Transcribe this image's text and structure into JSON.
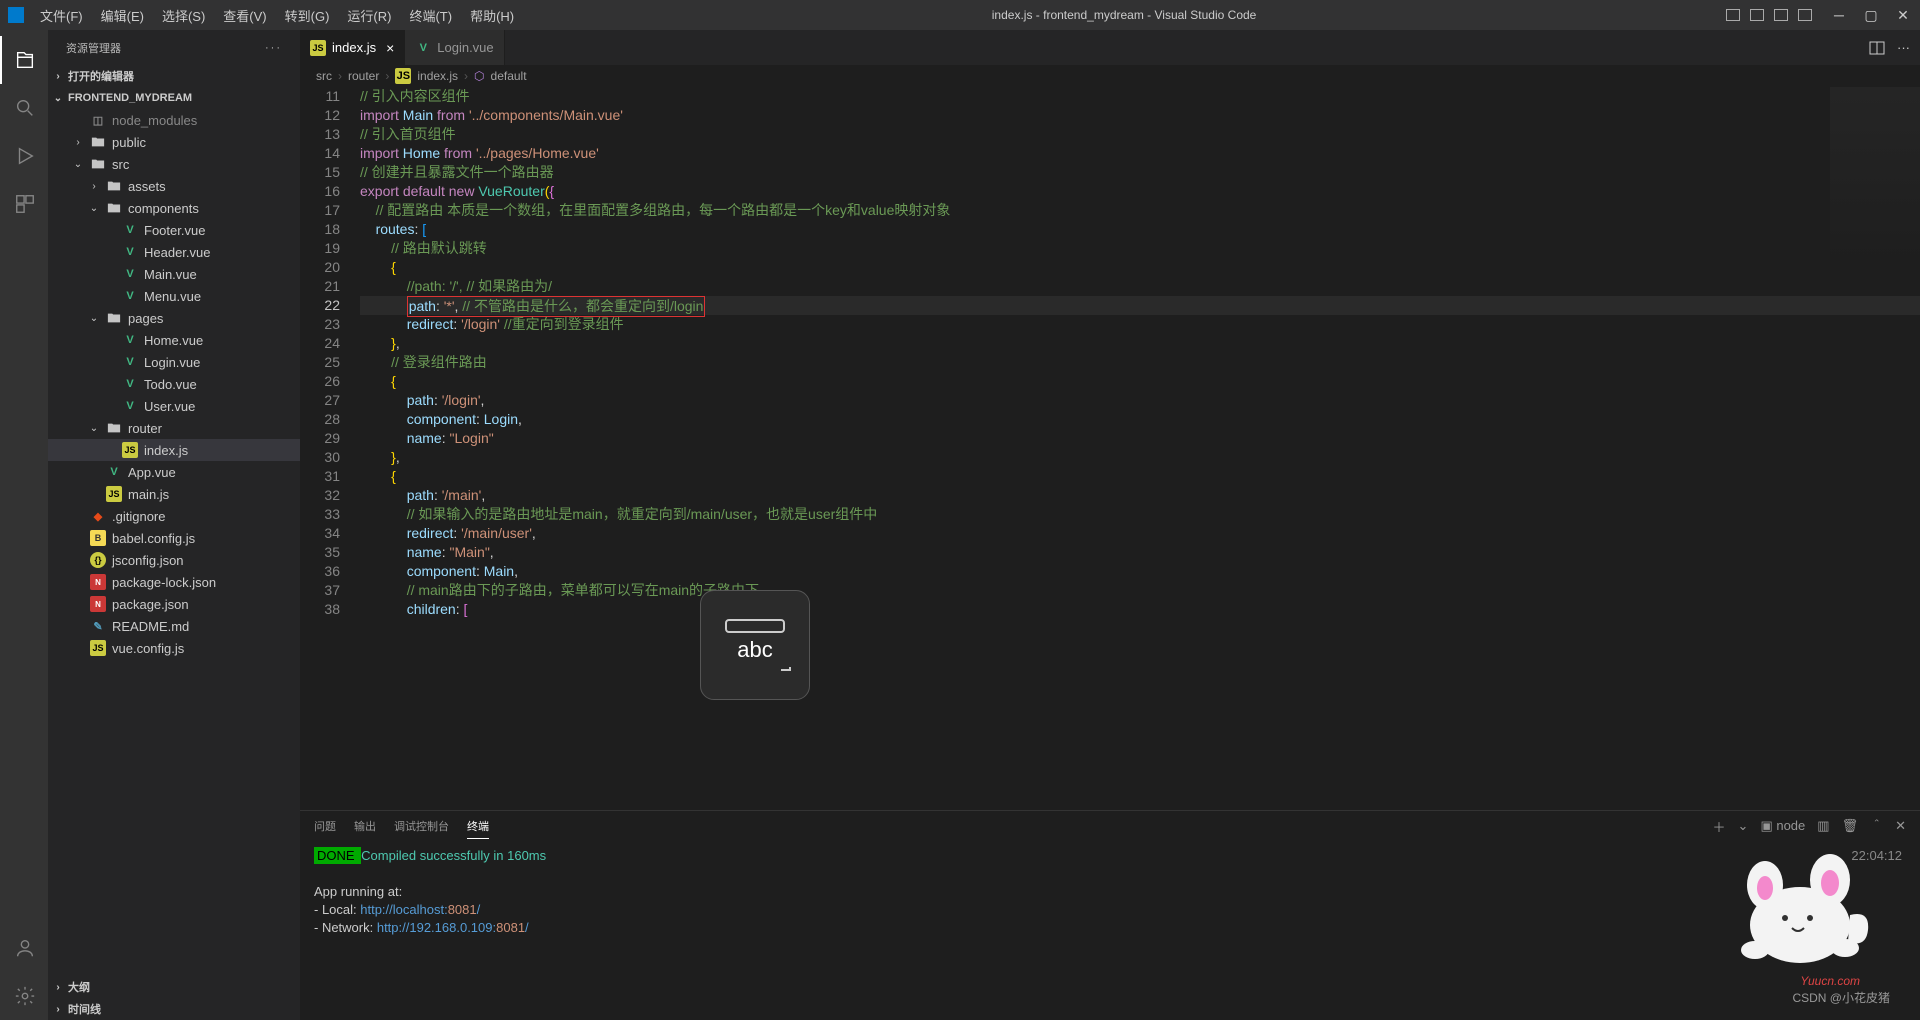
{
  "window": {
    "title": "index.js - frontend_mydream - Visual Studio Code"
  },
  "menu": [
    "文件(F)",
    "编辑(E)",
    "选择(S)",
    "查看(V)",
    "转到(G)",
    "运行(R)",
    "终端(T)",
    "帮助(H)"
  ],
  "sidebar": {
    "title": "资源管理器",
    "sections": {
      "openEditors": "打开的编辑器",
      "project": "FRONTEND_MYDREAM",
      "outline": "大纲",
      "timeline": "时间线"
    },
    "tree": [
      {
        "l": 1,
        "exp": null,
        "icon": "gray",
        "label": "node_modules",
        "dim": true
      },
      {
        "l": 1,
        "exp": false,
        "icon": "folder",
        "label": "public"
      },
      {
        "l": 1,
        "exp": true,
        "icon": "folder",
        "label": "src"
      },
      {
        "l": 2,
        "exp": false,
        "icon": "folder",
        "label": "assets"
      },
      {
        "l": 2,
        "exp": true,
        "icon": "folder",
        "label": "components"
      },
      {
        "l": 3,
        "exp": null,
        "icon": "vue",
        "label": "Footer.vue"
      },
      {
        "l": 3,
        "exp": null,
        "icon": "vue",
        "label": "Header.vue"
      },
      {
        "l": 3,
        "exp": null,
        "icon": "vue",
        "label": "Main.vue"
      },
      {
        "l": 3,
        "exp": null,
        "icon": "vue",
        "label": "Menu.vue"
      },
      {
        "l": 2,
        "exp": true,
        "icon": "folder",
        "label": "pages"
      },
      {
        "l": 3,
        "exp": null,
        "icon": "vue",
        "label": "Home.vue"
      },
      {
        "l": 3,
        "exp": null,
        "icon": "vue",
        "label": "Login.vue"
      },
      {
        "l": 3,
        "exp": null,
        "icon": "vue",
        "label": "Todo.vue"
      },
      {
        "l": 3,
        "exp": null,
        "icon": "vue",
        "label": "User.vue"
      },
      {
        "l": 2,
        "exp": true,
        "icon": "folder",
        "label": "router"
      },
      {
        "l": 3,
        "exp": null,
        "icon": "js",
        "label": "index.js",
        "active": true
      },
      {
        "l": 2,
        "exp": null,
        "icon": "vue",
        "label": "App.vue"
      },
      {
        "l": 2,
        "exp": null,
        "icon": "js",
        "label": "main.js"
      },
      {
        "l": 1,
        "exp": null,
        "icon": "git",
        "label": ".gitignore"
      },
      {
        "l": 1,
        "exp": null,
        "icon": "babel",
        "label": "babel.config.js"
      },
      {
        "l": 1,
        "exp": null,
        "icon": "json",
        "label": "jsconfig.json"
      },
      {
        "l": 1,
        "exp": null,
        "icon": "npm",
        "label": "package-lock.json"
      },
      {
        "l": 1,
        "exp": null,
        "icon": "npm",
        "label": "package.json"
      },
      {
        "l": 1,
        "exp": null,
        "icon": "md",
        "label": "README.md"
      },
      {
        "l": 1,
        "exp": null,
        "icon": "js",
        "label": "vue.config.js"
      }
    ]
  },
  "tabs": [
    {
      "icon": "js",
      "label": "index.js",
      "active": true,
      "close": true
    },
    {
      "icon": "vue",
      "label": "Login.vue",
      "active": false,
      "close": false
    }
  ],
  "breadcrumb": [
    "src",
    "router",
    "index.js",
    "default"
  ],
  "code": {
    "startLine": 11,
    "currentLine": 22,
    "lines": [
      [
        {
          "t": "cmt",
          "v": "// 引入内容区组件"
        }
      ],
      [
        {
          "t": "kw",
          "v": "import"
        },
        {
          "t": "pun",
          "v": " "
        },
        {
          "t": "var",
          "v": "Main"
        },
        {
          "t": "pun",
          "v": " "
        },
        {
          "t": "kw",
          "v": "from"
        },
        {
          "t": "pun",
          "v": " "
        },
        {
          "t": "str",
          "v": "'../components/Main.vue'"
        }
      ],
      [
        {
          "t": "cmt",
          "v": "// 引入首页组件"
        }
      ],
      [
        {
          "t": "kw",
          "v": "import"
        },
        {
          "t": "pun",
          "v": " "
        },
        {
          "t": "var",
          "v": "Home"
        },
        {
          "t": "pun",
          "v": " "
        },
        {
          "t": "kw",
          "v": "from"
        },
        {
          "t": "pun",
          "v": " "
        },
        {
          "t": "str",
          "v": "'../pages/Home.vue'"
        }
      ],
      [
        {
          "t": "cmt",
          "v": "// 创建并且暴露文件一个路由器"
        }
      ],
      [
        {
          "t": "kw",
          "v": "export"
        },
        {
          "t": "pun",
          "v": " "
        },
        {
          "t": "kw",
          "v": "default"
        },
        {
          "t": "pun",
          "v": " "
        },
        {
          "t": "kw",
          "v": "new"
        },
        {
          "t": "pun",
          "v": " "
        },
        {
          "t": "type",
          "v": "VueRouter"
        },
        {
          "t": "brace1",
          "v": "("
        },
        {
          "t": "brace2",
          "v": "{"
        }
      ],
      [
        {
          "t": "pun",
          "v": "    "
        },
        {
          "t": "cmt",
          "v": "// 配置路由 本质是一个数组，在里面配置多组路由，每一个路由都是一个key和value映射对象"
        }
      ],
      [
        {
          "t": "pun",
          "v": "    "
        },
        {
          "t": "var",
          "v": "routes"
        },
        {
          "t": "pun",
          "v": ": "
        },
        {
          "t": "brace3",
          "v": "["
        }
      ],
      [
        {
          "t": "pun",
          "v": "        "
        },
        {
          "t": "cmt",
          "v": "// 路由默认跳转"
        }
      ],
      [
        {
          "t": "pun",
          "v": "        "
        },
        {
          "t": "brace1",
          "v": "{"
        }
      ],
      [
        {
          "t": "pun",
          "v": "            "
        },
        {
          "t": "cmt",
          "v": "//path: '/', // 如果路由为/"
        }
      ],
      [
        {
          "t": "pun",
          "v": "            "
        },
        {
          "red": true,
          "parts": [
            {
              "t": "var",
              "v": "path"
            },
            {
              "t": "pun",
              "v": ": "
            },
            {
              "t": "str",
              "v": "'*'"
            },
            {
              "t": "pun",
              "v": ", "
            },
            {
              "t": "cmt",
              "v": "// 不管路由是什么，都会重定向到/login"
            }
          ]
        }
      ],
      [
        {
          "t": "pun",
          "v": "            "
        },
        {
          "t": "var",
          "v": "redirect"
        },
        {
          "t": "pun",
          "v": ": "
        },
        {
          "t": "str",
          "v": "'/login'"
        },
        {
          "t": "pun",
          "v": " "
        },
        {
          "t": "cmt",
          "v": "//重定向到登录组件"
        }
      ],
      [
        {
          "t": "pun",
          "v": "        "
        },
        {
          "t": "brace1",
          "v": "}"
        },
        {
          "t": "pun",
          "v": ","
        }
      ],
      [
        {
          "t": "pun",
          "v": "        "
        },
        {
          "t": "cmt",
          "v": "// 登录组件路由"
        }
      ],
      [
        {
          "t": "pun",
          "v": "        "
        },
        {
          "t": "brace1",
          "v": "{"
        }
      ],
      [
        {
          "t": "pun",
          "v": "            "
        },
        {
          "t": "var",
          "v": "path"
        },
        {
          "t": "pun",
          "v": ": "
        },
        {
          "t": "str",
          "v": "'/login'"
        },
        {
          "t": "pun",
          "v": ","
        }
      ],
      [
        {
          "t": "pun",
          "v": "            "
        },
        {
          "t": "var",
          "v": "component"
        },
        {
          "t": "pun",
          "v": ": "
        },
        {
          "t": "var",
          "v": "Login"
        },
        {
          "t": "pun",
          "v": ","
        }
      ],
      [
        {
          "t": "pun",
          "v": "            "
        },
        {
          "t": "var",
          "v": "name"
        },
        {
          "t": "pun",
          "v": ": "
        },
        {
          "t": "str",
          "v": "\"Login\""
        }
      ],
      [
        {
          "t": "pun",
          "v": "        "
        },
        {
          "t": "brace1",
          "v": "}"
        },
        {
          "t": "pun",
          "v": ","
        }
      ],
      [
        {
          "t": "pun",
          "v": "        "
        },
        {
          "t": "brace1",
          "v": "{"
        }
      ],
      [
        {
          "t": "pun",
          "v": "            "
        },
        {
          "t": "var",
          "v": "path"
        },
        {
          "t": "pun",
          "v": ": "
        },
        {
          "t": "str",
          "v": "'/main'"
        },
        {
          "t": "pun",
          "v": ","
        }
      ],
      [
        {
          "t": "pun",
          "v": "            "
        },
        {
          "t": "cmt",
          "v": "// 如果输入的是路由地址是main，就重定向到/main/user，也就是user组件中"
        }
      ],
      [
        {
          "t": "pun",
          "v": "            "
        },
        {
          "t": "var",
          "v": "redirect"
        },
        {
          "t": "pun",
          "v": ": "
        },
        {
          "t": "str",
          "v": "'/main/user'"
        },
        {
          "t": "pun",
          "v": ","
        }
      ],
      [
        {
          "t": "pun",
          "v": "            "
        },
        {
          "t": "var",
          "v": "name"
        },
        {
          "t": "pun",
          "v": ": "
        },
        {
          "t": "str",
          "v": "\"Main\""
        },
        {
          "t": "pun",
          "v": ","
        }
      ],
      [
        {
          "t": "pun",
          "v": "            "
        },
        {
          "t": "var",
          "v": "component"
        },
        {
          "t": "pun",
          "v": ": "
        },
        {
          "t": "var",
          "v": "Main"
        },
        {
          "t": "pun",
          "v": ","
        }
      ],
      [
        {
          "t": "pun",
          "v": "            "
        },
        {
          "t": "cmt",
          "v": "// main路由下的子路由，菜单都可以写在main的子路由下"
        }
      ],
      [
        {
          "t": "pun",
          "v": "            "
        },
        {
          "t": "var",
          "v": "children"
        },
        {
          "t": "pun",
          "v": ": "
        },
        {
          "t": "brace2",
          "v": "["
        }
      ]
    ]
  },
  "panel": {
    "tabs": [
      "问题",
      "输出",
      "调试控制台",
      "终端"
    ],
    "activeTab": 3,
    "shell": "node",
    "time": "22:04:12",
    "done": " DONE ",
    "compiled": " Compiled successfully in 160ms",
    "running": "App running at:",
    "local_lbl": "- Local:   ",
    "local_url": "http://localhost:",
    "local_port": "8081",
    "net_lbl": "- Network: ",
    "net_url": "http://192.168.0.109:",
    "net_port": "8081"
  },
  "popup": {
    "text": "abc"
  },
  "watermark": {
    "site": "Yuucn.com",
    "credit": "CSDN @小花皮猪"
  }
}
